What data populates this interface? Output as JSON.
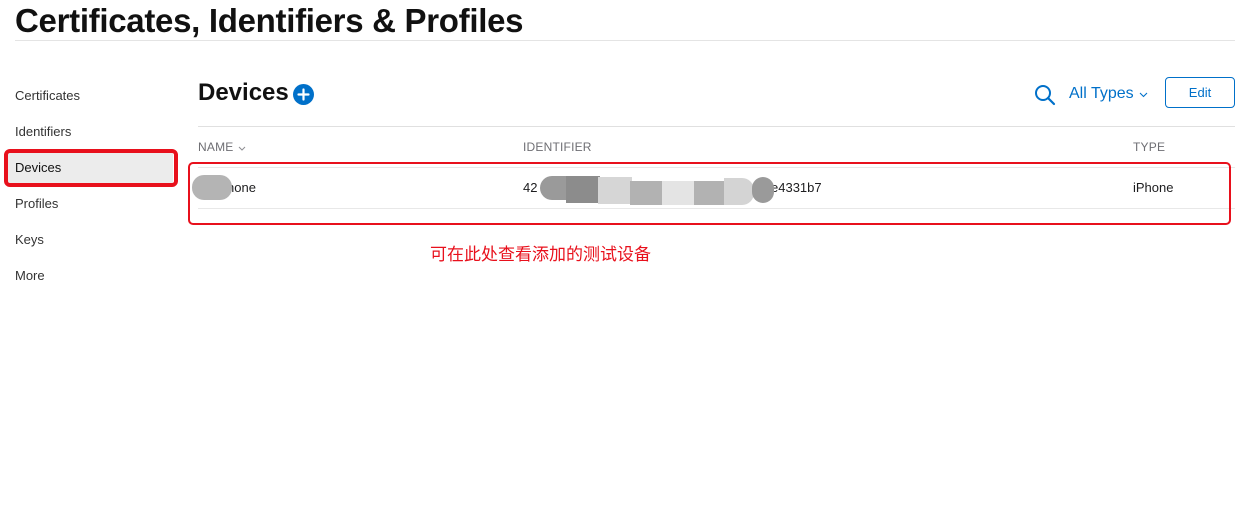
{
  "page": {
    "title": "Certificates, Identifiers & Profiles"
  },
  "sidebar": {
    "items": [
      {
        "label": "Certificates",
        "active": false
      },
      {
        "label": "Identifiers",
        "active": false
      },
      {
        "label": "Devices",
        "active": true
      },
      {
        "label": "Profiles",
        "active": false
      },
      {
        "label": "Keys",
        "active": false
      },
      {
        "label": "More",
        "active": false
      }
    ]
  },
  "section": {
    "title": "Devices",
    "add_icon": "plus-circle-icon"
  },
  "toolbar": {
    "search_icon": "search-icon",
    "filter_label": "All Types",
    "edit_label": "Edit"
  },
  "table": {
    "columns": [
      "NAME",
      "IDENTIFIER",
      "TYPE"
    ],
    "rows": [
      {
        "name": "hone",
        "identifier_start": "42",
        "identifier_end": "e4331b7",
        "type": "iPhone"
      }
    ]
  },
  "annotation": {
    "text": "可在此处查看添加的测试设备",
    "color": "#e8101c"
  },
  "colors": {
    "accent": "#0070c9",
    "annotation": "#e8101c",
    "selected_bg": "#ececec"
  }
}
